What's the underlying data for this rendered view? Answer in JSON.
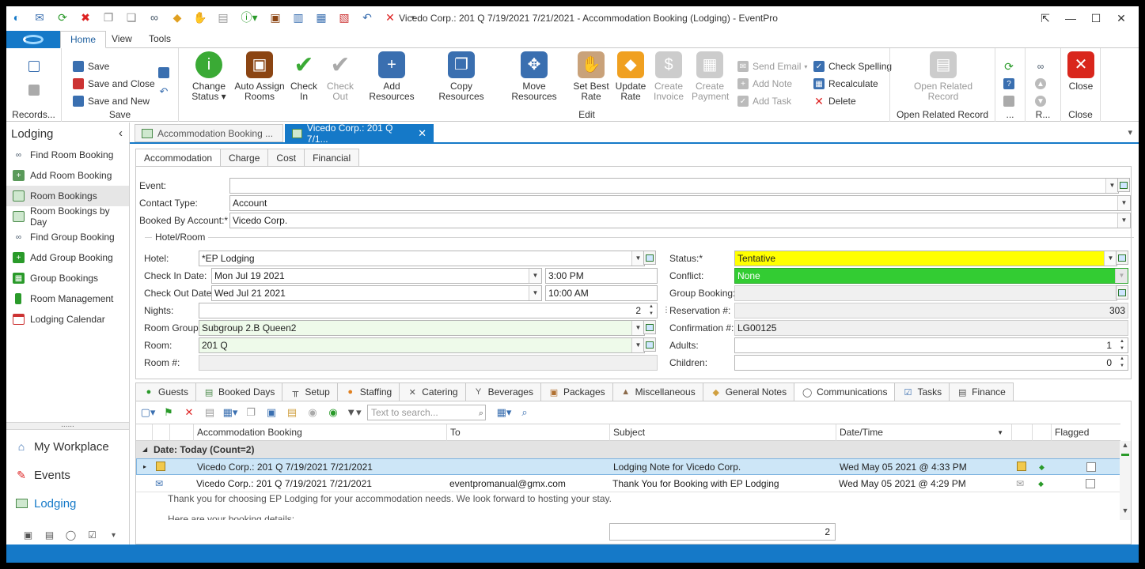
{
  "window": {
    "title": "Vicedo Corp.: 201 Q 7/19/2021 7/21/2021  - Accommodation Booking (Lodging) - EventPro"
  },
  "ribbon_tabs": [
    "Home",
    "View",
    "Tools"
  ],
  "ribbon": {
    "records_label": "Records...",
    "save": {
      "save": "Save",
      "save_close": "Save and Close",
      "save_new": "Save and New",
      "label": "Save"
    },
    "edit": {
      "change_status": [
        "Change",
        "Status ▾"
      ],
      "auto_assign": [
        "Auto Assign",
        "Rooms"
      ],
      "check_in": [
        "Check",
        "In"
      ],
      "check_out": [
        "Check",
        "Out"
      ],
      "add_resources": "Add Resources",
      "copy_resources": "Copy Resources",
      "move_resources": "Move Resources",
      "set_best_rate": [
        "Set Best",
        "Rate"
      ],
      "update_rate": [
        "Update",
        "Rate"
      ],
      "create_invoice": [
        "Create",
        "Invoice"
      ],
      "create_payment": [
        "Create",
        "Payment"
      ],
      "send_email": "Send Email",
      "add_note": "Add Note",
      "add_task": "Add Task",
      "check_spelling": "Check Spelling",
      "recalculate": "Recalculate",
      "delete": "Delete",
      "label": "Edit"
    },
    "open_related": {
      "button": [
        "Open Related",
        "Record"
      ],
      "label": "Open Related Record"
    },
    "more_label": "...",
    "r_label": "R...",
    "close": {
      "button": "Close",
      "label": "Close"
    }
  },
  "sidebar": {
    "title": "Lodging",
    "items": [
      {
        "label": "Find Room Booking",
        "icon": "binoculars-icon"
      },
      {
        "label": "Add Room Booking",
        "icon": "add-booking-icon"
      },
      {
        "label": "Room Bookings",
        "icon": "bookings-icon",
        "active": true
      },
      {
        "label": "Room Bookings by Day",
        "icon": "bookings-day-icon"
      },
      {
        "label": "Find Group Booking",
        "icon": "binoculars-icon"
      },
      {
        "label": "Add Group Booking",
        "icon": "add-group-icon"
      },
      {
        "label": "Group Bookings",
        "icon": "group-icon"
      },
      {
        "label": "Room Management",
        "icon": "key-icon"
      },
      {
        "label": "Lodging Calendar",
        "icon": "calendar-icon"
      }
    ],
    "splitter": "......",
    "bottom_nav": [
      "My Workplace",
      "Events",
      "Lodging"
    ]
  },
  "doc_tabs": [
    {
      "label": "Accommodation Booking ..."
    },
    {
      "label": "Vicedo Corp.: 201 Q 7/1..."
    }
  ],
  "sub_tabs": [
    "Accommodation",
    "Charge",
    "Cost",
    "Financial"
  ],
  "form": {
    "event_label": "Event:",
    "event_value": "",
    "contact_type_label": "Contact Type:",
    "contact_type_value": "Account",
    "booked_by_label": "Booked By Account:*",
    "booked_by_value": "Vicedo Corp.",
    "group_title": "Hotel/Room",
    "hotel_label": "Hotel:",
    "hotel_value": "*EP Lodging",
    "checkin_label": "Check In Date:",
    "checkin_date": "Mon Jul 19 2021",
    "checkin_time": "3:00 PM",
    "checkout_label": "Check Out Date:",
    "checkout_date": "Wed Jul 21 2021",
    "checkout_time": "10:00 AM",
    "nights_label": "Nights:",
    "nights_value": "2",
    "room_group_label": "Room Group:",
    "room_group_value": "Subgroup 2.B Queen2",
    "room_label": "Room:",
    "room_value": "201 Q",
    "room_num_label": "Room #:",
    "room_num_value": "",
    "status_label": "Status:*",
    "status_value": "Tentative",
    "conflict_label": "Conflict:",
    "conflict_value": "None",
    "group_booking_label": "Group Booking:",
    "group_booking_value": "",
    "reservation_label": "Reservation #:",
    "reservation_value": "303",
    "confirmation_label": "Confirmation #:",
    "confirmation_value": "LG00125",
    "adults_label": "Adults:",
    "adults_value": "1",
    "children_label": "Children:",
    "children_value": "0"
  },
  "colors": {
    "accent": "#1579c8",
    "status_yellow": "#ffff00",
    "conflict_green": "#33cc33"
  },
  "lower_tabs": [
    "Guests",
    "Booked Days",
    "Setup",
    "Staffing",
    "Catering",
    "Beverages",
    "Packages",
    "Miscellaneous",
    "General Notes",
    "Communications",
    "Tasks",
    "Finance"
  ],
  "grid": {
    "search_placeholder": "Text to search...",
    "columns": [
      "Accommodation Booking",
      "To",
      "Subject",
      "Date/Time",
      "Flagged"
    ],
    "group_row": "Date: Today (Count=2)",
    "rows": [
      {
        "booking": "Vicedo Corp.: 201 Q 7/19/2021 7/21/2021",
        "to": "",
        "subject": "Lodging Note for Vicedo Corp.",
        "datetime": "Wed May 05 2021 @ 4:33 PM"
      },
      {
        "booking": "Vicedo Corp.: 201 Q 7/19/2021 7/21/2021",
        "to": "eventpromanual@gmx.com",
        "subject": "Thank You for Booking with EP Lodging",
        "datetime": "Wed May 05 2021 @ 4:29 PM"
      }
    ],
    "preview_line1": "Thank you for choosing EP Lodging for your accommodation needs. We look forward to hosting your stay.",
    "preview_line2": "Here are your booking details:",
    "footer_count": "2"
  }
}
